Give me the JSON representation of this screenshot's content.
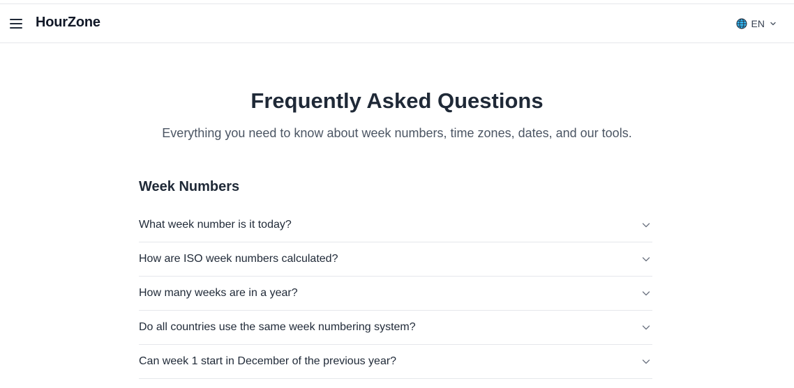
{
  "header": {
    "brand": "HourZone",
    "menu_icon": "hamburger-menu-icon",
    "language": {
      "icon": "globe-icon",
      "label": "EN",
      "chevron_icon": "chevron-down-icon"
    }
  },
  "hero": {
    "title": "Frequently Asked Questions",
    "subtitle": "Everything you need to know about week numbers, time zones, dates, and our tools."
  },
  "sections": [
    {
      "title": "Week Numbers",
      "questions": [
        "What week number is it today?",
        "How are ISO week numbers calculated?",
        "How many weeks are in a year?",
        "Do all countries use the same week numbering system?",
        "Can week 1 start in December of the previous year?"
      ]
    }
  ],
  "colors": {
    "text_primary": "#1f2937",
    "text_secondary": "#4b5563",
    "divider": "#e5e7eb",
    "globe": "#0ea5e9"
  }
}
